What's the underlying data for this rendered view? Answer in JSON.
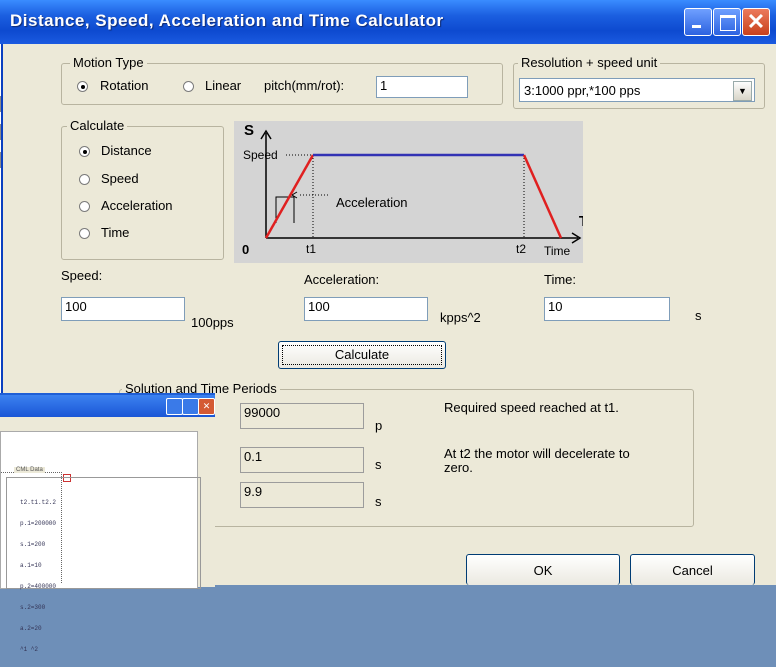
{
  "window": {
    "title": "Distance, Speed, Acceleration and Time Calculator",
    "close_glyph": "✕"
  },
  "background_window": {
    "panel_label": "CML Data",
    "cml_lines": [
      "t2.t1.t2.2",
      "p.1=200000",
      "s.1=200",
      "a.1=10",
      "p.2=400000",
      "s.2=300",
      "a.2=20",
      "^1 ^2"
    ],
    "close_glyph": "✕"
  },
  "motion_type": {
    "legend": "Motion Type",
    "options": [
      "Rotation",
      "Linear"
    ],
    "selected": "Rotation",
    "pitch_label": "pitch(mm/rot):",
    "pitch_value": "1"
  },
  "resolution": {
    "legend": "Resolution + speed unit",
    "selected": "3:1000 ppr,*100 pps",
    "arrow_glyph": "▼"
  },
  "calculate_group": {
    "legend": "Calculate",
    "options": [
      "Distance",
      "Speed",
      "Acceleration",
      "Time"
    ],
    "selected": "Distance"
  },
  "diagram": {
    "y_axis": "S",
    "x_axis": "T",
    "origin": "0",
    "speed_label": "Speed",
    "acceleration_label": "Acceleration",
    "t1": "t1",
    "t2": "t2",
    "time_label": "Time"
  },
  "inputs": {
    "speed": {
      "label": "Speed:",
      "value": "100",
      "unit": "100pps"
    },
    "acceleration": {
      "label": "Acceleration:",
      "value": "100",
      "unit": "kpps^2"
    },
    "time": {
      "label": "Time:",
      "value": "10",
      "unit": "s"
    }
  },
  "calculate_button": "Calculate",
  "solution": {
    "legend": "Solution and Time Periods",
    "rows": [
      {
        "value": "99000",
        "unit": "p"
      },
      {
        "value": "0.1",
        "unit": "s"
      },
      {
        "value": "9.9",
        "unit": "s"
      }
    ],
    "note1": "Required speed reached at t1.",
    "note2": "At t2 the motor will decelerate to zero."
  },
  "buttons": {
    "ok": "OK",
    "cancel": "Cancel"
  },
  "colors": {
    "title_blue": "#1b5fe0",
    "profile_line": "#3232b4",
    "ramp_line": "#e02020",
    "dialog_bg": "#ece9d8"
  }
}
